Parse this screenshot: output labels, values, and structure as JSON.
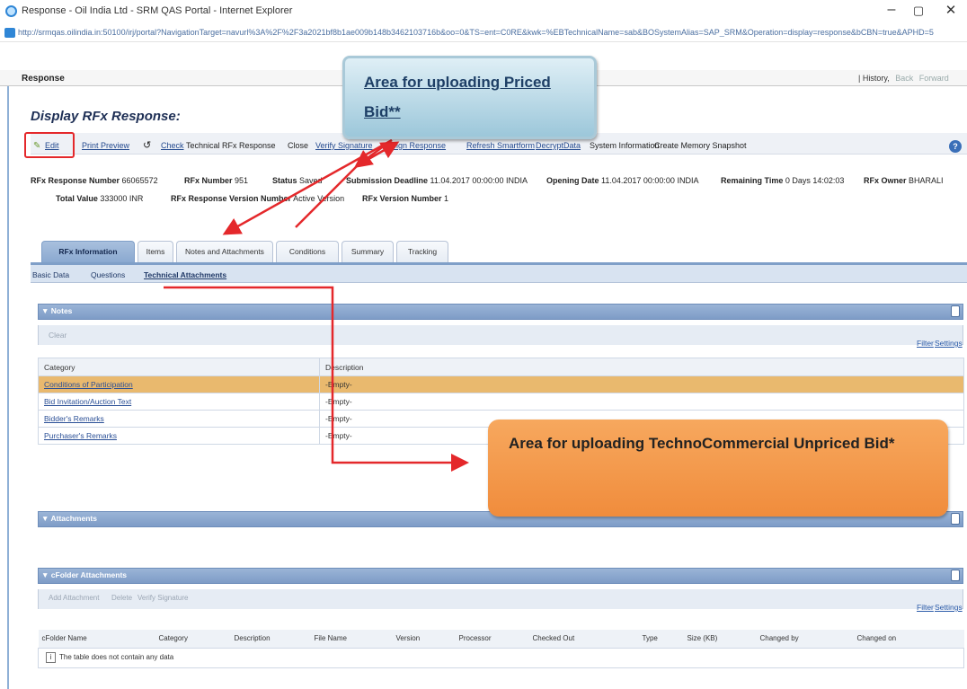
{
  "window": {
    "title": "Response - Oil India Ltd - SRM QAS Portal - Internet Explorer",
    "url": "http://srmqas.oilindia.in:50100/irj/portal?NavigationTarget=navurl%3A%2F%2F3a2021bf8b1ae009b148b3462103716b&oo=0&TS=ent=C0RE&kwk=%EBTechnicalName=sab&BOSystemAlias=SAP_SRM&Operation=display=response&bCBN=true&APHD=5"
  },
  "portal": {
    "title": "Response",
    "history": "History",
    "back": "Back",
    "forward": "Forward"
  },
  "page": {
    "heading": "Display RFx Response:"
  },
  "toolbar": {
    "edit": "Edit",
    "print_preview": "Print Preview",
    "check": "Check",
    "technical_rfx_response": "Technical RFx Response",
    "close": "Close",
    "verify_signature": "Verify Signature",
    "sign_response": "Sign Response",
    "refresh_smartforms": "Refresh Smartform",
    "decrypt_data": "DecryptData",
    "system_information": "System Information",
    "create_memory_snapshot": "Create Memory Snapshot"
  },
  "header_info": {
    "rfx_response_number_label": "RFx Response Number",
    "rfx_response_number": "66065572",
    "rfx_number_label": "RFx Number",
    "rfx_number": "951",
    "status_label": "Status",
    "status": "Saved",
    "submission_deadline_label": "Submission Deadline",
    "submission_deadline": "11.04.2017 00:00:00 INDIA",
    "opening_date_label": "Opening Date",
    "opening_date": "11.04.2017 00:00:00 INDIA",
    "remaining_time_label": "Remaining Time",
    "remaining_time": "0 Days 14:02:03",
    "rfx_owner_label": "RFx Owner",
    "rfx_owner": "BHARALI",
    "total_value_label": "Total Value",
    "total_value": "333000 INR",
    "rfx_response_version_label": "RFx Response Version Number",
    "rfx_response_version": "Active Version",
    "rfx_version_label": "RFx Version Number",
    "rfx_version": "1"
  },
  "tabs": [
    "RFx Information",
    "Items",
    "Notes and Attachments",
    "Conditions",
    "Summary",
    "Tracking"
  ],
  "subnav": [
    "Basic Data",
    "Questions",
    "Technical Attachments"
  ],
  "notes": {
    "title": "Notes",
    "clear": "Clear",
    "filter": "Filter",
    "settings": "Settings",
    "columns": [
      "Category",
      "Description"
    ],
    "rows": [
      {
        "category": "Conditions of Participation",
        "description": "-Empty-"
      },
      {
        "category": "Bid Invitation/Auction Text",
        "description": "-Empty-"
      },
      {
        "category": "Bidder's Remarks",
        "description": "-Empty-"
      },
      {
        "category": "Purchaser's Remarks",
        "description": "-Empty-"
      }
    ]
  },
  "attachments": {
    "title": "Attachments"
  },
  "dfolder": {
    "title": "cFolder Attachments",
    "add_attachment": "Add Attachment",
    "delete": "Delete",
    "verify_signature": "Verify Signature",
    "filter": "Filter",
    "settings": "Settings",
    "columns": [
      "cFolder Name",
      "Category",
      "Description",
      "File Name",
      "Version",
      "Processor",
      "Checked Out",
      "Type",
      "Size (KB)",
      "Changed by",
      "Changed on"
    ],
    "empty_text": "The table does not contain any data"
  },
  "callouts": {
    "priced": "Area for uploading Priced Bid**",
    "unpriced": "Area for uploading TechnoCommercial Unpriced Bid*"
  },
  "colors": {
    "arrow": "#e4282b",
    "priced_callout": "#9cc7da",
    "unpriced_callout": "#f08c3c",
    "selected_row": "#e9b96e"
  }
}
